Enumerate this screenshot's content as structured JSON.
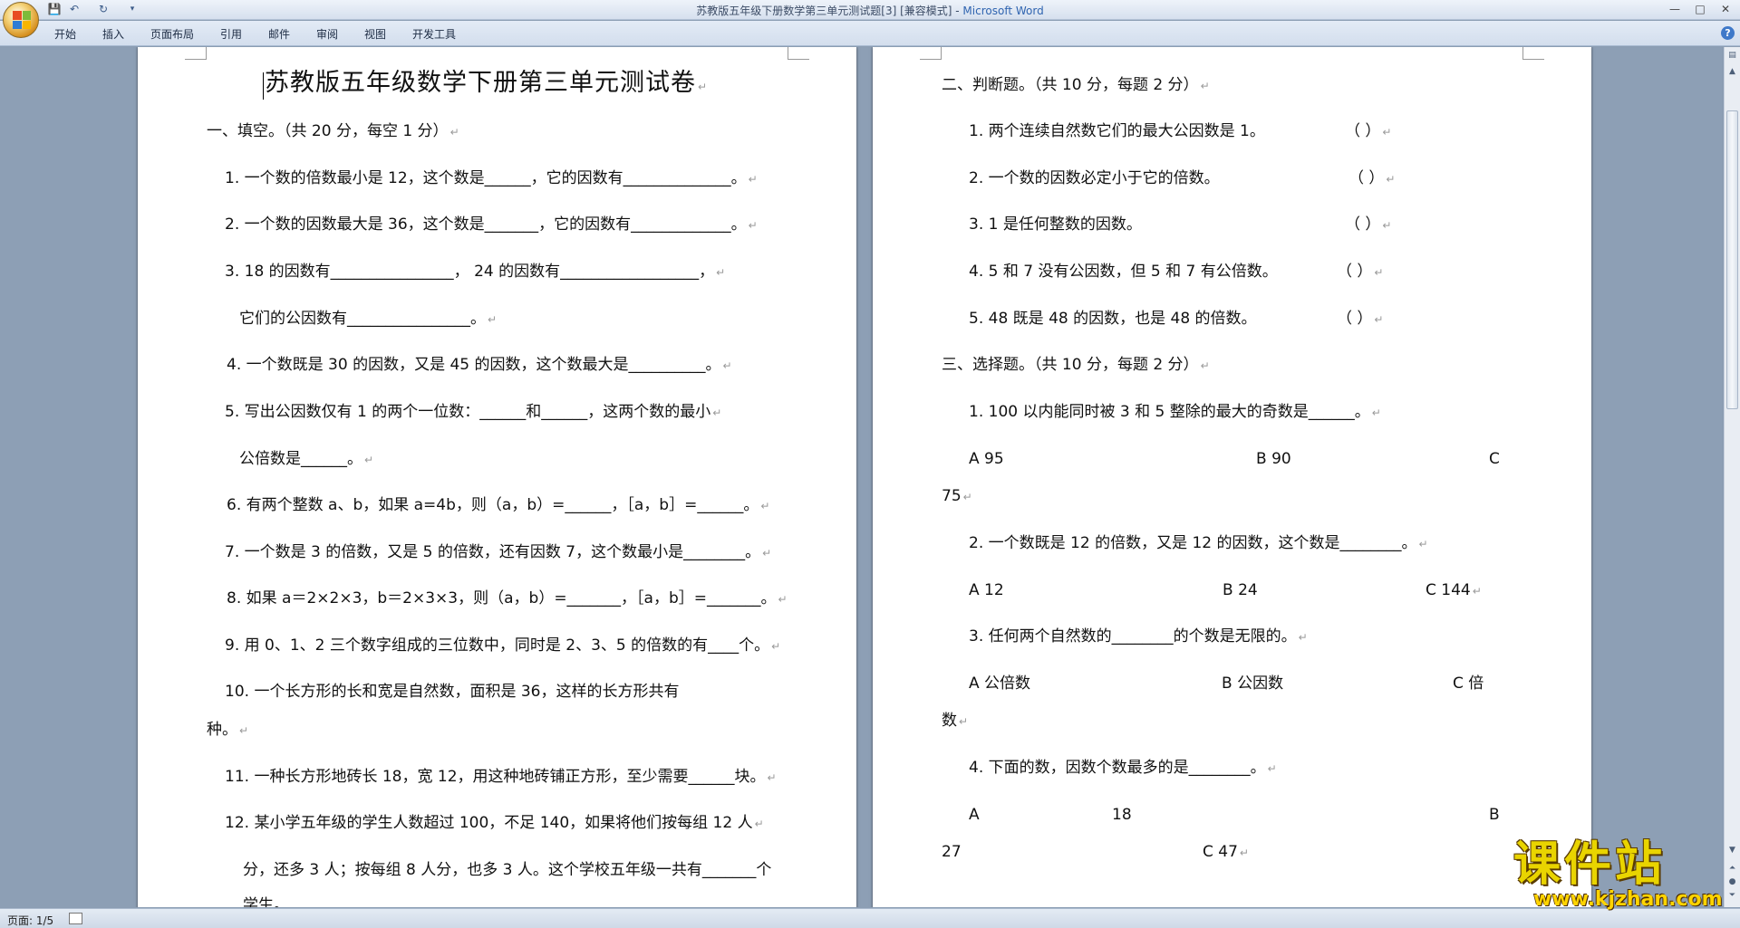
{
  "window": {
    "title": "苏教版五年级下册数学第三单元测试题[3] [兼容模式] - ",
    "app_name": "Microsoft Word",
    "controls": [
      "—",
      "□",
      "✕"
    ]
  },
  "quick_access": [
    "save-icon",
    "undo-icon",
    "redo-icon",
    "customize-icon"
  ],
  "ribbon": {
    "tabs": [
      "开始",
      "插入",
      "页面布局",
      "引用",
      "邮件",
      "审阅",
      "视图",
      "开发工具"
    ]
  },
  "status": {
    "page_count": "页面: 1/5"
  },
  "watermark": {
    "big": "课件站",
    "small": "www.kjzhan.com"
  },
  "page1": {
    "title": "苏教版五年级数学下册第三单元测试卷",
    "lines": [
      "一、填空。（共 20 分，每空 1 分）",
      "1. 一个数的倍数最小是 12，这个数是______，它的因数有______________。",
      "2. 一个数的因数最大是 36，这个数是_______，它的因数有_____________。",
      "3. 18 的因数有________________，  24 的因数有__________________，",
      "它们的公因数有________________。",
      "4. 一个数既是 30 的因数，又是 45 的因数，这个数最大是__________。",
      "5. 写出公因数仅有 1 的两个一位数：______和______，这两个数的最小",
      "公倍数是______。",
      "6. 有两个整数 a、b，如果 a=4b，则（a，b）=______，［a，b］=______。",
      "7. 一个数是 3 的倍数，又是 5 的倍数，还有因数 7，这个数最小是________。",
      "8. 如果 a＝2×2×3，b＝2×3×3，则（a，b）=_______，［a，b］=_______。",
      "9. 用 0、1、2 三个数字组成的三位数中，同时是 2、3、5 的倍数的有____个。",
      "10. 一个长方形的长和宽是自然数，面积是 36，这样的长方形共有",
      "种。",
      "11. 一种长方形地砖长 18，宽 12，用这种地砖铺正方形，至少需要______块。",
      "12. 某小学五年级的学生人数超过 100，不足 140，如果将他们按每组 12 人",
      "分，还多 3 人；按每组 8 人分，也多 3 人。这个学校五年级一共有_______个",
      "学生。"
    ]
  },
  "page2": {
    "lines": [
      "二、判断题。（共 10 分，每题 2 分）",
      "1. 两个连续自然数它们的最大公因数是 1。",
      "2. 一个数的因数必定小于它的倍数。",
      "3. 1 是任何整数的因数。",
      "4. 5 和 7 没有公因数，但 5 和 7 有公倍数。",
      "5. 48 既是 48 的因数，也是 48 的倍数。",
      "三、选择题。（共 10 分，每题 2 分）",
      "1. 100 以内能同时被 3 和 5 整除的最大的奇数是______。",
      "A   95",
      "B   90",
      "C",
      "75",
      "2. 一个数既是 12 的倍数，又是 12 的因数，这个数是________。",
      "A   12",
      "B   24",
      "C    144",
      "3. 任何两个自然数的________的个数是无限的。",
      "A   公倍数",
      "B   公因数",
      "C   倍",
      "数",
      "4. 下面的数，因数个数最多的是________。",
      "A",
      "18",
      "B",
      "27",
      "C   47"
    ],
    "brackets": [
      "（          ）",
      "（     ）",
      "（     ）",
      "（          ）",
      "（     ）"
    ]
  }
}
